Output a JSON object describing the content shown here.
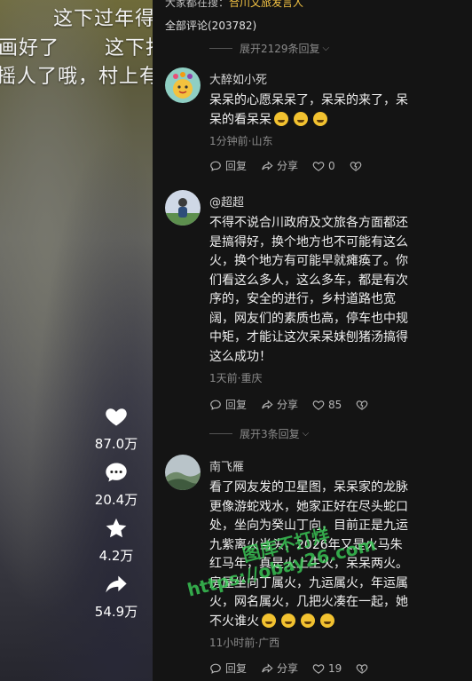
{
  "video": {
    "subtitles": [
      "这下过年得",
      "画好了",
      "这下打",
      "摇人了哦，村上有"
    ],
    "actions": [
      {
        "icon": "heart-icon",
        "count": "87.0万"
      },
      {
        "icon": "comment-icon",
        "count": "20.4万"
      },
      {
        "icon": "star-icon",
        "count": "4.2万"
      },
      {
        "icon": "share-icon",
        "count": "54.9万"
      }
    ]
  },
  "panel": {
    "search_hint_prefix": "大家都在搜：",
    "search_hint_keyword": "合川文旅发言人",
    "comment_count": "全部评论(203782)",
    "expand_top": "展开2129条回复",
    "expand_mid": "展开3条回复",
    "comments": [
      {
        "name": "大醉如小死",
        "text": "呆呆的心愿呆呆了，呆呆的来了，呆呆的看呆呆",
        "meta": "1分钟前·山东",
        "reply": "回复",
        "share": "分享",
        "likes": "0"
      },
      {
        "name": "@超超",
        "text": "不得不说合川政府及文旅各方面都还是搞得好，换个地方也不可能有这么火，换个地方有可能早就瘫痪了。你们看这么多人，这么多车，都是有次序的，安全的进行，乡村道路也宽阔，网友们的素质也高，停车也中规中矩，才能让这次呆呆妹刨猪汤搞得这么成功！",
        "meta": "1天前·重庆",
        "reply": "回复",
        "share": "分享",
        "likes": "85"
      },
      {
        "name": "南飞雁",
        "text": "看了网友发的卫星图，呆呆家的龙脉更像游蛇戏水，她家正好在尽头蛇口处，坐向为癸山丁向，目前正是九运九紫离火当头，2026年又是火马朱红马年，真是火上生火，呆呆两火。房屋坐向丁属火，九运属火，年运属火，网名属火，几把火凑在一起，她不火谁火",
        "meta": "11小时前·广西",
        "reply": "回复",
        "share": "分享",
        "likes": "19"
      }
    ]
  },
  "watermark": {
    "line1": "图库不打烊",
    "line2": "https://obay26.com"
  }
}
